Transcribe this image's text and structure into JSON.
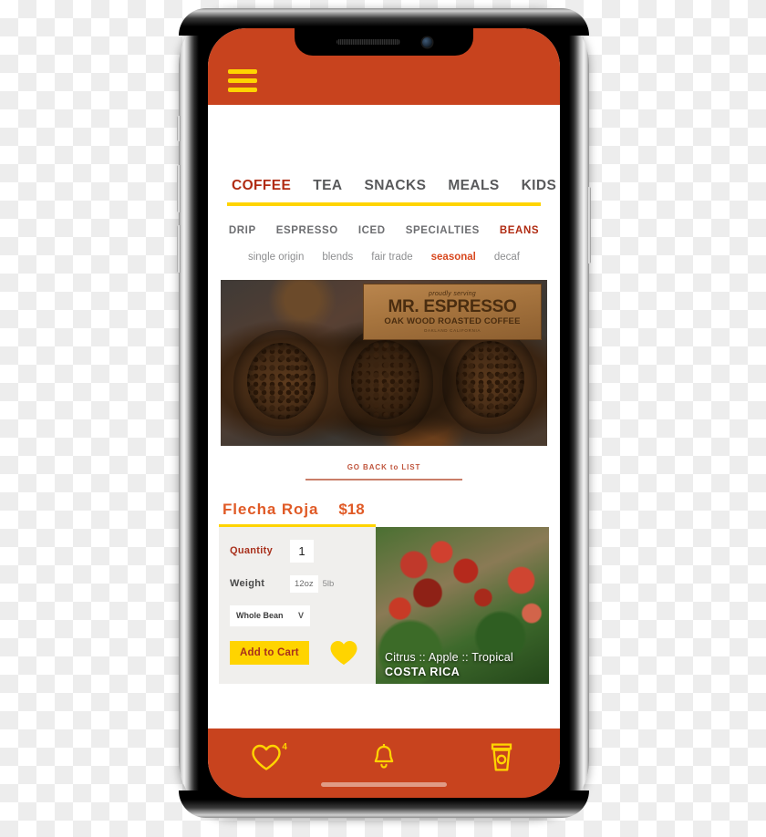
{
  "app": {
    "header": {
      "menu_icon": "hamburger-menu-icon"
    }
  },
  "main_tabs": [
    {
      "label": "COFFEE",
      "active": true
    },
    {
      "label": "TEA",
      "active": false
    },
    {
      "label": "SNACKS",
      "active": false
    },
    {
      "label": "MEALS",
      "active": false
    },
    {
      "label": "KIDS",
      "active": false
    }
  ],
  "sub_tabs": [
    {
      "label": "DRIP",
      "active": false
    },
    {
      "label": "ESPRESSO",
      "active": false
    },
    {
      "label": "ICED",
      "active": false
    },
    {
      "label": "SPECIALTIES",
      "active": false
    },
    {
      "label": "BEANS",
      "active": true
    }
  ],
  "filter_tabs": [
    {
      "label": "single origin",
      "active": false
    },
    {
      "label": "blends",
      "active": false
    },
    {
      "label": "fair trade",
      "active": false
    },
    {
      "label": "seasonal",
      "active": true
    },
    {
      "label": "decaf",
      "active": false
    }
  ],
  "hero": {
    "alt": "coffee-beans-banner",
    "sign_pre": "proudly serving",
    "sign_main": "MR. ESPRESSO",
    "sign_sub": "OAK WOOD ROASTED COFFEE",
    "sign_location": "OAKLAND CALIFORNIA"
  },
  "back_link": {
    "label": "GO BACK to LIST"
  },
  "product": {
    "name": "Flecha Roja",
    "price": "$18",
    "quantity_label": "Quantity",
    "quantity_value": "1",
    "weight_label": "Weight",
    "weight_options": [
      {
        "label": "12oz",
        "selected": true
      },
      {
        "label": "5lb",
        "selected": false
      }
    ],
    "grind": {
      "value": "Whole Bean",
      "chevron": "V"
    },
    "add_to_cart_label": "Add to Cart",
    "favorite_icon": "heart-icon",
    "photo": {
      "alt": "coffee-cherries-photo",
      "caption_tasting": "Citrus :: Apple :: Tropical",
      "caption_origin": "COSTA RICA"
    }
  },
  "bottom_nav": [
    {
      "icon": "heart-icon",
      "badge": "4"
    },
    {
      "icon": "bell-icon",
      "badge": ""
    },
    {
      "icon": "coffee-cup-icon",
      "badge": ""
    }
  ],
  "colors": {
    "brand_orange": "#C8431E",
    "accent_yellow": "#FFD400",
    "active_red": "#B02B12",
    "product_orange": "#E05A26",
    "panel_gray": "#F0EFED"
  }
}
